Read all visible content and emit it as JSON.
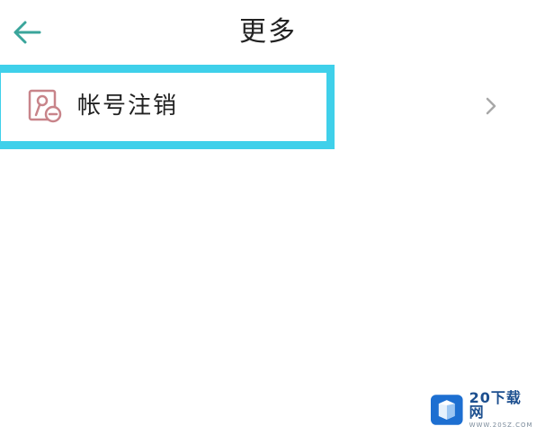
{
  "header": {
    "back_icon": "arrow-left-icon",
    "title": "更多"
  },
  "menu": {
    "items": [
      {
        "icon": "account-cancel-icon",
        "label": "帐号注销",
        "chevron_icon": "chevron-right-icon",
        "highlighted": true
      }
    ]
  },
  "watermark": {
    "name": "20下载网",
    "url": "WWW.20SZ.COM"
  },
  "colors": {
    "accent": "#3aa59b",
    "highlight": "#3fd0ea",
    "icon": "#c8848a",
    "text": "#222222",
    "chevron": "#a8a8a8",
    "background": "#ffffff"
  }
}
